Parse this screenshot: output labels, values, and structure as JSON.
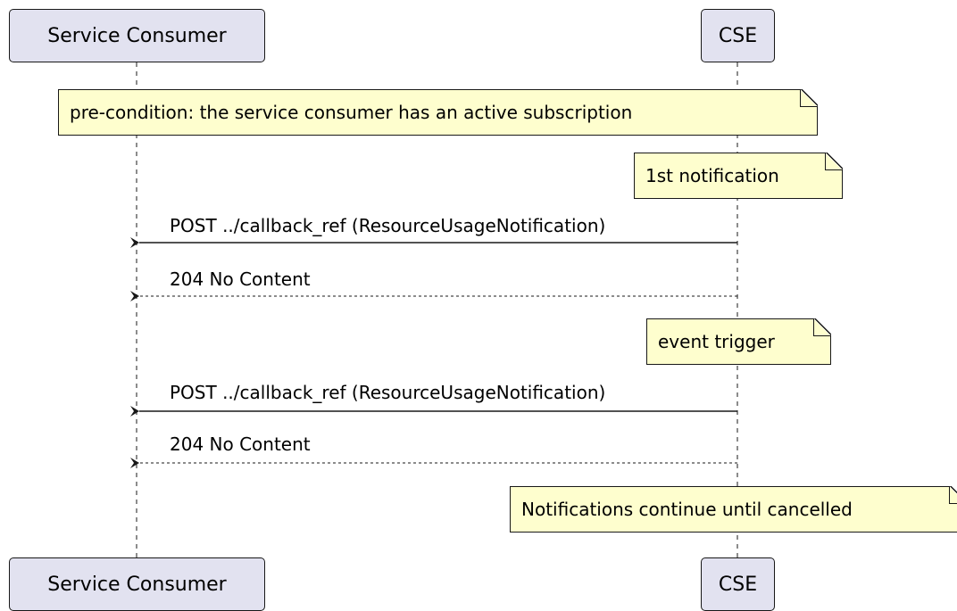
{
  "participants": {
    "consumer": "Service Consumer",
    "cse": "CSE"
  },
  "notes": {
    "precondition": "pre-condition: the service consumer has an active subscription",
    "first_notification": "1st notification",
    "event_trigger": "event trigger",
    "continue": "Notifications continue until cancelled"
  },
  "messages": [
    {
      "from": "cse",
      "to": "consumer",
      "label": "POST ../callback_ref (ResourceUsageNotification)",
      "style": "solid"
    },
    {
      "from": "cse",
      "to": "consumer",
      "label": "204 No Content",
      "style": "dashed"
    },
    {
      "from": "cse",
      "to": "consumer",
      "label": "POST ../callback_ref (ResourceUsageNotification)",
      "style": "solid"
    },
    {
      "from": "cse",
      "to": "consumer",
      "label": "204 No Content",
      "style": "dashed"
    }
  ],
  "colors": {
    "participant_fill": "#e2e2f0",
    "note_fill": "#fefece",
    "line": "#181818"
  }
}
